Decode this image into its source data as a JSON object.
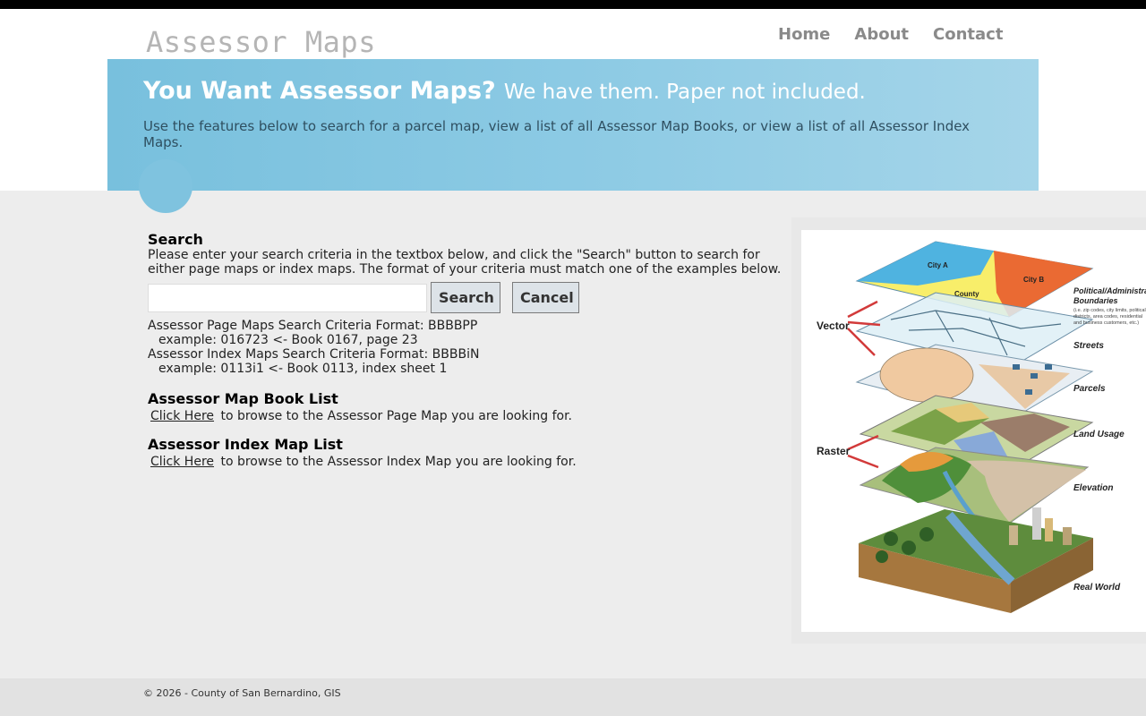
{
  "site": {
    "title": "Assessor Maps"
  },
  "nav": [
    {
      "label": "Home"
    },
    {
      "label": "About"
    },
    {
      "label": "Contact"
    }
  ],
  "hero": {
    "title_strong": "You Want Assessor Maps?",
    "title_light": "We have them. Paper not included.",
    "description": "Use the features below to search for a parcel map, view a list of all Assessor Map Books, or view a list of all Assessor Index Maps."
  },
  "search": {
    "title": "Search",
    "instructions": "Please enter your search criteria in the textbox below, and click the \"Search\" button to search for either page maps or index maps. The format of your criteria must match one of the examples below.",
    "input_value": "",
    "search_label": "Search",
    "cancel_label": "Cancel",
    "formats": [
      {
        "format": "Assessor Page Maps Search Criteria Format: BBBBPP",
        "example": "example: 016723 <- Book 0167, page 23"
      },
      {
        "format": "Assessor Index Maps Search Criteria Format: BBBBiN",
        "example": "example: 0113i1 <- Book 0113, index sheet 1"
      }
    ]
  },
  "book_list": {
    "title": "Assessor Map Book List",
    "link_label": "Click Here",
    "suffix": "to browse to the Assessor Page Map you are looking for."
  },
  "index_list": {
    "title": "Assessor Index Map List",
    "link_label": "Click Here",
    "suffix": "to browse to the Assessor Index Map you are looking for."
  },
  "figure": {
    "labels": {
      "city_a": "City A",
      "city_b": "City B",
      "county": "County",
      "political": "Political/Administrative",
      "boundaries": "Boundaries",
      "boundaries_note_1": "(i.e. zip codes, city limits, political",
      "boundaries_note_2": "districts, area codes, residential",
      "boundaries_note_3": "and business customers, etc.)",
      "vector": "Vector",
      "raster": "Raster",
      "streets": "Streets",
      "parcels": "Parcels",
      "land_usage": "Land Usage",
      "elevation": "Elevation",
      "real_world": "Real World"
    }
  },
  "footer": {
    "text": "© 2026 - County of San Bernardino, GIS"
  },
  "colors": {
    "hero_start": "#78c0dd",
    "hero_end": "#a5d5e9",
    "nav": "#8a8a8a",
    "city_a": "#4fb3e0",
    "city_b": "#ea6a33",
    "county": "#f8ee6a"
  }
}
